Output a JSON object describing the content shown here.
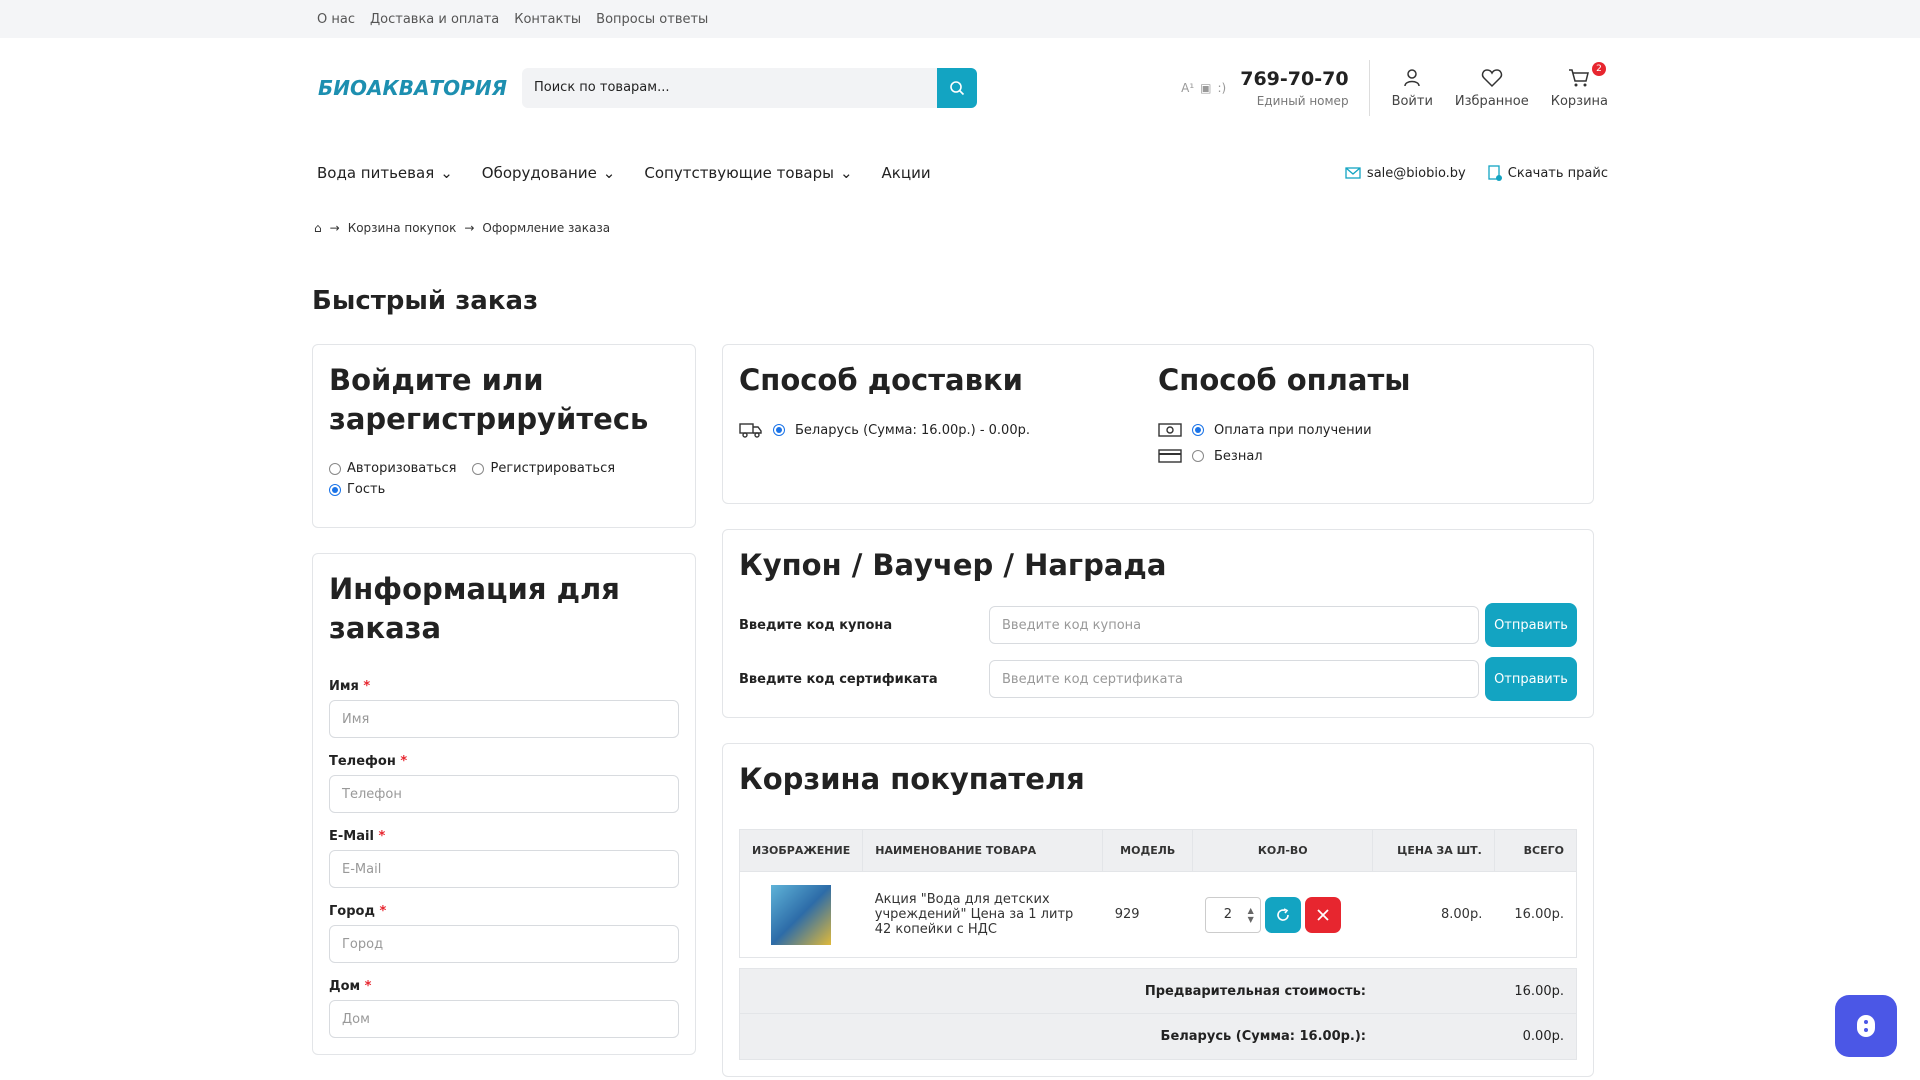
{
  "topbar": {
    "links": [
      "О нас",
      "Доставка и оплата",
      "Контакты",
      "Вопросы ответы"
    ]
  },
  "logo": {
    "text": "БИОАКВАТОРИЯ"
  },
  "search": {
    "placeholder": "Поиск по товарам..."
  },
  "phone": {
    "number": "769-70-70",
    "label": "Единый номер"
  },
  "header_icons": {
    "login": "Войти",
    "favorites": "Избранное",
    "cart": "Корзина",
    "cart_count": "2"
  },
  "nav": {
    "items": [
      "Вода питьевая",
      "Оборудование",
      "Сопутствующие товары",
      "Акции"
    ],
    "email": "sale@biobio.by",
    "price": "Скачать прайс"
  },
  "breadcrumbs": [
    "Корзина покупок",
    "Оформление заказа"
  ],
  "page_title": "Быстрый заказ",
  "auth": {
    "title": "Войдите или зарегистрируйтесь",
    "options": [
      "Авторизоваться",
      "Регистрироваться",
      "Гость"
    ],
    "selected": "Гость"
  },
  "info": {
    "title": "Информация для заказа",
    "fields": [
      {
        "label": "Имя",
        "placeholder": "Имя"
      },
      {
        "label": "Телефон",
        "placeholder": "Телефон"
      },
      {
        "label": "E-Mail",
        "placeholder": "E-Mail"
      },
      {
        "label": "Город",
        "placeholder": "Город"
      },
      {
        "label": "Дом",
        "placeholder": "Дом"
      }
    ]
  },
  "delivery": {
    "title": "Способ доставки",
    "option": "Беларусь (Сумма: 16.00р.) - 0.00р."
  },
  "payment": {
    "title": "Способ оплаты",
    "options": [
      "Оплата при получении",
      "Безнал"
    ]
  },
  "coupon": {
    "title": "Купон / Ваучер / Награда",
    "coupon_label": "Введите код купона",
    "coupon_placeholder": "Введите код купона",
    "cert_label": "Введите код сертификата",
    "cert_placeholder": "Введите код сертификата",
    "send": "Отправить"
  },
  "cart": {
    "title": "Корзина покупателя",
    "headers": [
      "Изображение",
      "Наименование товара",
      "Модель",
      "Кол-во",
      "Цена за шт.",
      "Всего"
    ],
    "item": {
      "name": "Акция \"Вода для детских учреждений\" Цена за 1 литр 42 копейки с НДС",
      "model": "929",
      "qty": "2",
      "price": "8.00р.",
      "total": "16.00р."
    },
    "totals": [
      {
        "label": "Предварительная стоимость:",
        "value": "16.00р."
      },
      {
        "label": "Беларусь (Сумма: 16.00р.):",
        "value": "0.00р."
      }
    ]
  },
  "colors": {
    "accent": "#13a4c2",
    "danger": "#e7262f",
    "chat": "#4b57e6"
  }
}
